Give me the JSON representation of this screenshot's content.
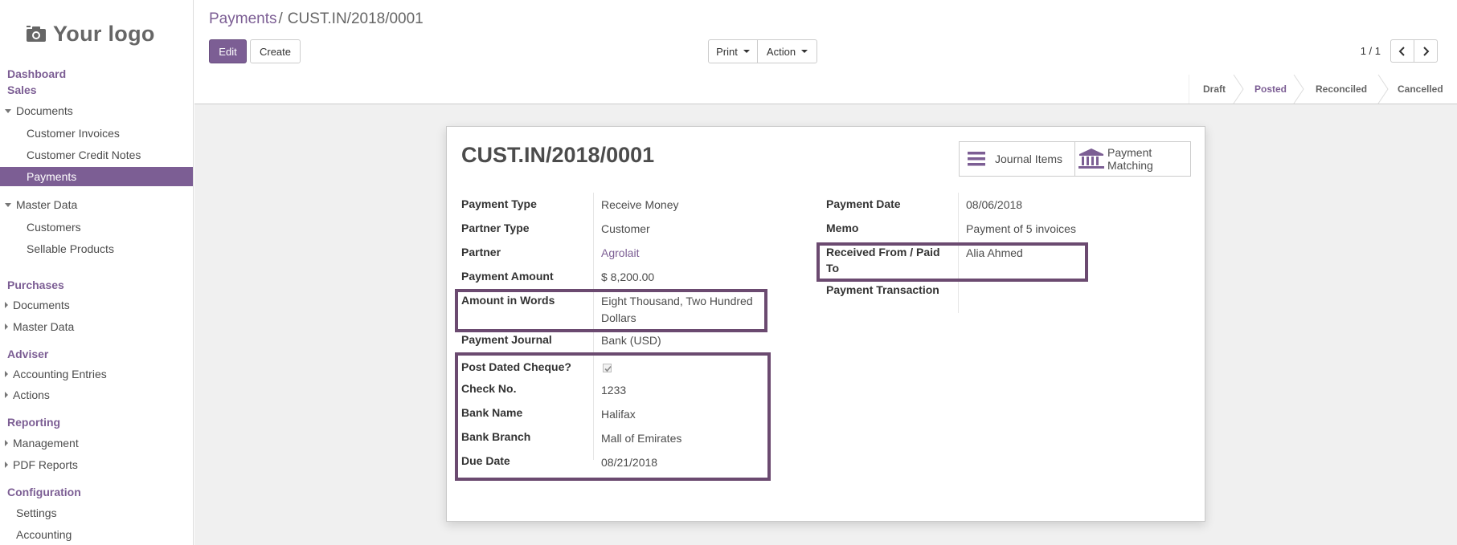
{
  "sidebar": {
    "logo_text": "Your logo",
    "dashboard": "Dashboard",
    "sales": "Sales",
    "sales_documents": "Documents",
    "customer_invoices": "Customer Invoices",
    "customer_credit_notes": "Customer Credit Notes",
    "payments": "Payments",
    "master_data": "Master Data",
    "customers": "Customers",
    "sellable_products": "Sellable Products",
    "purchases": "Purchases",
    "purchases_documents": "Documents",
    "purchases_master_data": "Master Data",
    "adviser": "Adviser",
    "accounting_entries": "Accounting Entries",
    "actions": "Actions",
    "reporting": "Reporting",
    "management": "Management",
    "pdf_reports": "PDF Reports",
    "configuration": "Configuration",
    "settings": "Settings",
    "accounting": "Accounting"
  },
  "header": {
    "breadcrumb_parent": "Payments",
    "breadcrumb_sep": "/",
    "breadcrumb_current": "CUST.IN/2018/0001",
    "edit_label": "Edit",
    "create_label": "Create",
    "print_label": "Print",
    "action_label": "Action",
    "pager": "1 / 1"
  },
  "status": {
    "stages": [
      "Draft",
      "Posted",
      "Reconciled",
      "Cancelled"
    ],
    "active": "Posted"
  },
  "form": {
    "title": "CUST.IN/2018/0001",
    "journal_items_label": "Journal Items",
    "payment_matching_label_1": "Payment",
    "payment_matching_label_2": "Matching",
    "left": {
      "payment_type_label": "Payment Type",
      "payment_type_value": "Receive Money",
      "partner_type_label": "Partner Type",
      "partner_type_value": "Customer",
      "partner_label": "Partner",
      "partner_value": "Agrolait",
      "payment_amount_label": "Payment Amount",
      "payment_amount_value": "$ 8,200.00",
      "amount_words_label": "Amount in Words",
      "amount_words_value_1": "Eight Thousand, Two Hundred",
      "amount_words_value_2": "Dollars",
      "payment_journal_label": "Payment Journal",
      "payment_journal_value": "Bank (USD)",
      "post_dated_label": "Post Dated Cheque?",
      "post_dated_checked": true,
      "check_no_label": "Check No.",
      "check_no_value": "1233",
      "bank_name_label": "Bank Name",
      "bank_name_value": "Halifax",
      "bank_branch_label": "Bank Branch",
      "bank_branch_value": "Mall of Emirates",
      "due_date_label": "Due Date",
      "due_date_value": "08/21/2018"
    },
    "right": {
      "payment_date_label": "Payment Date",
      "payment_date_value": "08/06/2018",
      "memo_label": "Memo",
      "memo_value": "Payment of 5 invoices",
      "received_from_label_1": "Received From / Paid",
      "received_from_label_2": "To",
      "received_from_value": "Alia Ahmed",
      "payment_transaction_label": "Payment Transaction"
    }
  },
  "colors": {
    "brand": "#7c5e94",
    "highlight_border": "#6b4a70"
  }
}
